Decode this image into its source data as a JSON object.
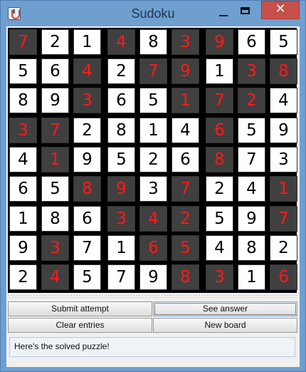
{
  "window": {
    "title": "Sudoku",
    "close_symbol": "✕"
  },
  "board": {
    "rows": [
      [
        {
          "v": "7",
          "given": false
        },
        {
          "v": "2",
          "given": true
        },
        {
          "v": "1",
          "given": true
        },
        {
          "v": "4",
          "given": false
        },
        {
          "v": "8",
          "given": true
        },
        {
          "v": "3",
          "given": false
        },
        {
          "v": "9",
          "given": false
        },
        {
          "v": "6",
          "given": true
        },
        {
          "v": "5",
          "given": true
        }
      ],
      [
        {
          "v": "5",
          "given": true
        },
        {
          "v": "6",
          "given": true
        },
        {
          "v": "4",
          "given": false
        },
        {
          "v": "2",
          "given": true
        },
        {
          "v": "7",
          "given": false
        },
        {
          "v": "9",
          "given": false
        },
        {
          "v": "1",
          "given": true
        },
        {
          "v": "3",
          "given": false
        },
        {
          "v": "8",
          "given": false
        }
      ],
      [
        {
          "v": "8",
          "given": true
        },
        {
          "v": "9",
          "given": true
        },
        {
          "v": "3",
          "given": false
        },
        {
          "v": "6",
          "given": true
        },
        {
          "v": "5",
          "given": true
        },
        {
          "v": "1",
          "given": false
        },
        {
          "v": "7",
          "given": false
        },
        {
          "v": "2",
          "given": false
        },
        {
          "v": "4",
          "given": true
        }
      ],
      [
        {
          "v": "3",
          "given": false
        },
        {
          "v": "7",
          "given": false
        },
        {
          "v": "2",
          "given": true
        },
        {
          "v": "8",
          "given": true
        },
        {
          "v": "1",
          "given": true
        },
        {
          "v": "4",
          "given": true
        },
        {
          "v": "6",
          "given": false
        },
        {
          "v": "5",
          "given": true
        },
        {
          "v": "9",
          "given": true
        }
      ],
      [
        {
          "v": "4",
          "given": true
        },
        {
          "v": "1",
          "given": false
        },
        {
          "v": "9",
          "given": true
        },
        {
          "v": "5",
          "given": true
        },
        {
          "v": "2",
          "given": true
        },
        {
          "v": "6",
          "given": true
        },
        {
          "v": "8",
          "given": false
        },
        {
          "v": "7",
          "given": true
        },
        {
          "v": "3",
          "given": true
        }
      ],
      [
        {
          "v": "6",
          "given": true
        },
        {
          "v": "5",
          "given": true
        },
        {
          "v": "8",
          "given": false
        },
        {
          "v": "9",
          "given": false
        },
        {
          "v": "3",
          "given": true
        },
        {
          "v": "7",
          "given": false
        },
        {
          "v": "2",
          "given": true
        },
        {
          "v": "4",
          "given": true
        },
        {
          "v": "1",
          "given": false
        }
      ],
      [
        {
          "v": "1",
          "given": true
        },
        {
          "v": "8",
          "given": true
        },
        {
          "v": "6",
          "given": true
        },
        {
          "v": "3",
          "given": false
        },
        {
          "v": "4",
          "given": false
        },
        {
          "v": "2",
          "given": false
        },
        {
          "v": "5",
          "given": true
        },
        {
          "v": "9",
          "given": true
        },
        {
          "v": "7",
          "given": false
        }
      ],
      [
        {
          "v": "9",
          "given": true
        },
        {
          "v": "3",
          "given": false
        },
        {
          "v": "7",
          "given": true
        },
        {
          "v": "1",
          "given": true
        },
        {
          "v": "6",
          "given": false
        },
        {
          "v": "5",
          "given": false
        },
        {
          "v": "4",
          "given": true
        },
        {
          "v": "8",
          "given": true
        },
        {
          "v": "2",
          "given": true
        }
      ],
      [
        {
          "v": "2",
          "given": true
        },
        {
          "v": "4",
          "given": false
        },
        {
          "v": "5",
          "given": true
        },
        {
          "v": "7",
          "given": true
        },
        {
          "v": "9",
          "given": true
        },
        {
          "v": "8",
          "given": false
        },
        {
          "v": "3",
          "given": false
        },
        {
          "v": "1",
          "given": true
        },
        {
          "v": "6",
          "given": false
        }
      ]
    ]
  },
  "buttons": {
    "submit": "Submit attempt",
    "see_answer": "See answer",
    "clear": "Clear entries",
    "new_board": "New board"
  },
  "status_text": "Here's the solved puzzle!",
  "colors": {
    "solved_cell_bg": "#404040",
    "solved_digit": "#ff1a1a",
    "given_cell_bg": "#ffffff",
    "given_digit": "#000000"
  },
  "icons": {
    "app": "java-cup-icon",
    "minimize": "minimize-icon",
    "maximize": "maximize-icon",
    "close": "close-icon"
  }
}
